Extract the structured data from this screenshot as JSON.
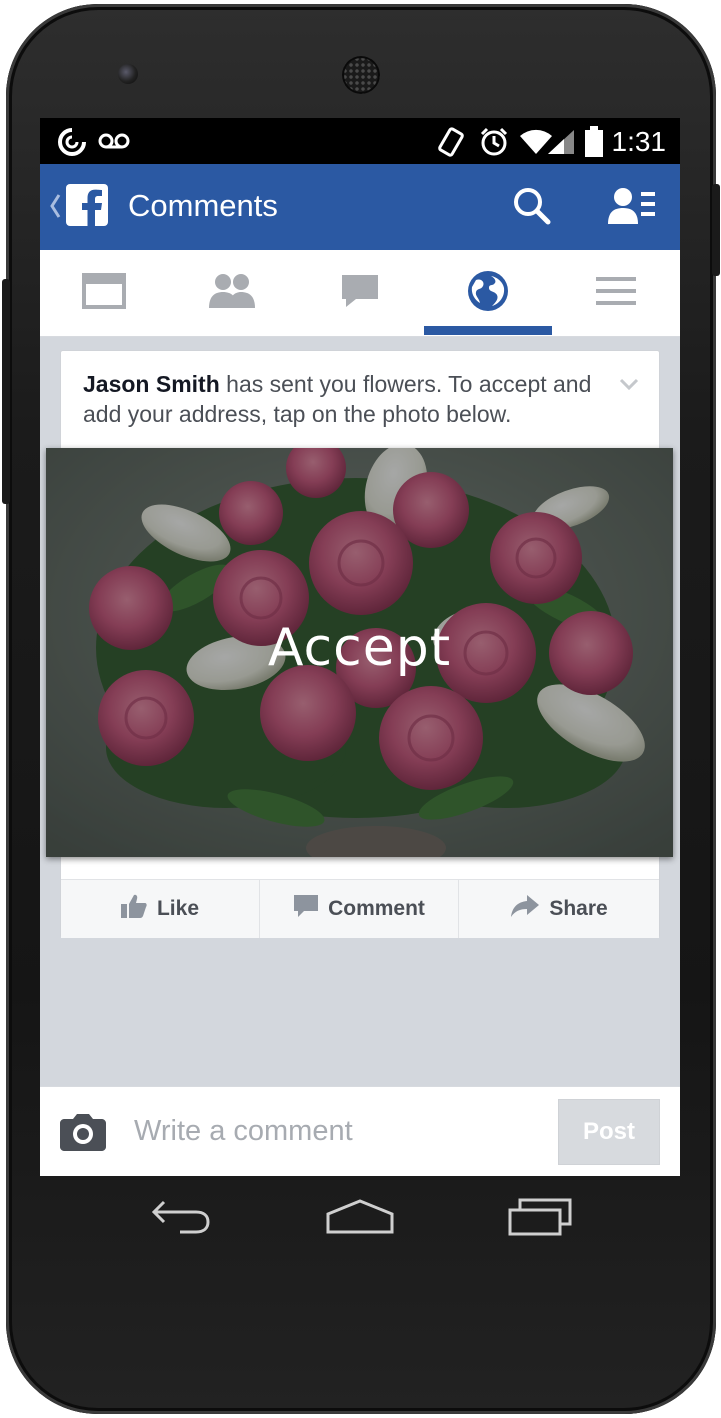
{
  "status_bar": {
    "time": "1:31",
    "icons": [
      "sync-icon",
      "voicemail-icon",
      "vibrate-icon",
      "alarm-icon",
      "wifi-icon",
      "signal-icon",
      "battery-icon"
    ]
  },
  "app_bar": {
    "title": "Comments",
    "back_icon": "chevron-left-icon",
    "logo": "facebook-logo",
    "actions": [
      "search-icon",
      "friend-requests-icon"
    ]
  },
  "tabs": [
    {
      "icon": "news-feed-icon",
      "selected": false
    },
    {
      "icon": "friends-icon",
      "selected": false
    },
    {
      "icon": "messages-icon",
      "selected": false
    },
    {
      "icon": "globe-notifications-icon",
      "selected": true
    },
    {
      "icon": "menu-icon",
      "selected": false
    }
  ],
  "post": {
    "author": "Jason Smith",
    "message": " has sent you flowers. To accept and add your address, tap on the photo below.",
    "photo_overlay_text": "Accept",
    "actions": [
      {
        "label": "Like",
        "icon": "thumbs-up-icon"
      },
      {
        "label": "Comment",
        "icon": "comment-icon"
      },
      {
        "label": "Share",
        "icon": "share-arrow-icon"
      }
    ]
  },
  "composer": {
    "placeholder": "Write a comment",
    "post_label": "Post",
    "camera_icon": "camera-icon"
  },
  "nav_bar": [
    "back-icon",
    "home-icon",
    "recents-icon"
  ],
  "colors": {
    "facebook_blue": "#2b59a3",
    "background": "#d3d7dd",
    "text_dark": "#141823",
    "text_gray": "#4b4f56"
  }
}
